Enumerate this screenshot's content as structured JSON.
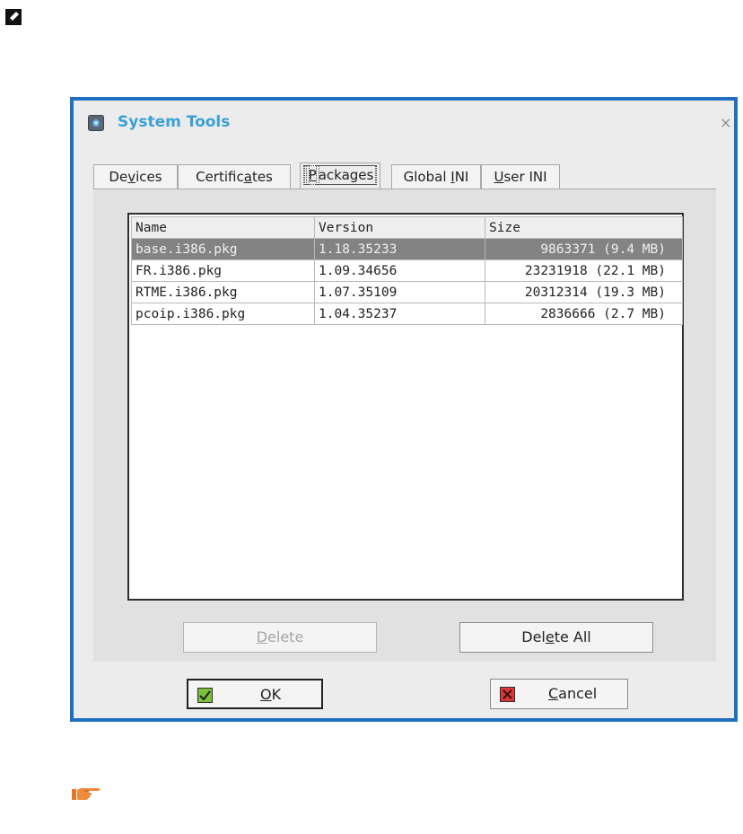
{
  "dialog": {
    "title": "System Tools",
    "close": "×",
    "tabs": [
      {
        "pre": "De",
        "key": "v",
        "post": "ices"
      },
      {
        "pre": "Certific",
        "key": "a",
        "post": "tes"
      },
      {
        "pre": "",
        "key": "P",
        "post": "ackages"
      },
      {
        "pre": "Global ",
        "key": "I",
        "post": "NI"
      },
      {
        "pre": "",
        "key": "U",
        "post": "ser INI"
      }
    ],
    "active_tab": "Packages"
  },
  "packages_table": {
    "columns": [
      "Name",
      "Version",
      "Size"
    ],
    "rows": [
      {
        "name": "base.i386.pkg",
        "version": "1.18.35233",
        "size": "9863371 (9.4 MB)",
        "selected": true
      },
      {
        "name": "FR.i386.pkg",
        "version": "1.09.34656",
        "size": "23231918 (22.1 MB)"
      },
      {
        "name": "RTME.i386.pkg",
        "version": "1.07.35109",
        "size": "20312314 (19.3 MB)"
      },
      {
        "name": "pcoip.i386.pkg",
        "version": "1.04.35237",
        "size": "2836666 (2.7 MB)"
      }
    ]
  },
  "buttons": {
    "delete": {
      "pre": "",
      "key": "D",
      "post": "elete"
    },
    "delete_all": {
      "pre": "Del",
      "key": "e",
      "post": "te All"
    },
    "ok": {
      "pre": "",
      "key": "O",
      "post": "K"
    },
    "cancel": {
      "pre": "",
      "key": "C",
      "post": "ancel"
    }
  },
  "colors": {
    "dialog_border": "#1f6fc4",
    "title_text": "#3aa0d5",
    "selected_row": "#838383"
  },
  "icons": {
    "note": "pencil-note-icon",
    "hand": "pointing-hand-icon",
    "app": "system-tools-icon",
    "ok": "checkmark-icon",
    "cancel": "cancel-x-icon"
  }
}
